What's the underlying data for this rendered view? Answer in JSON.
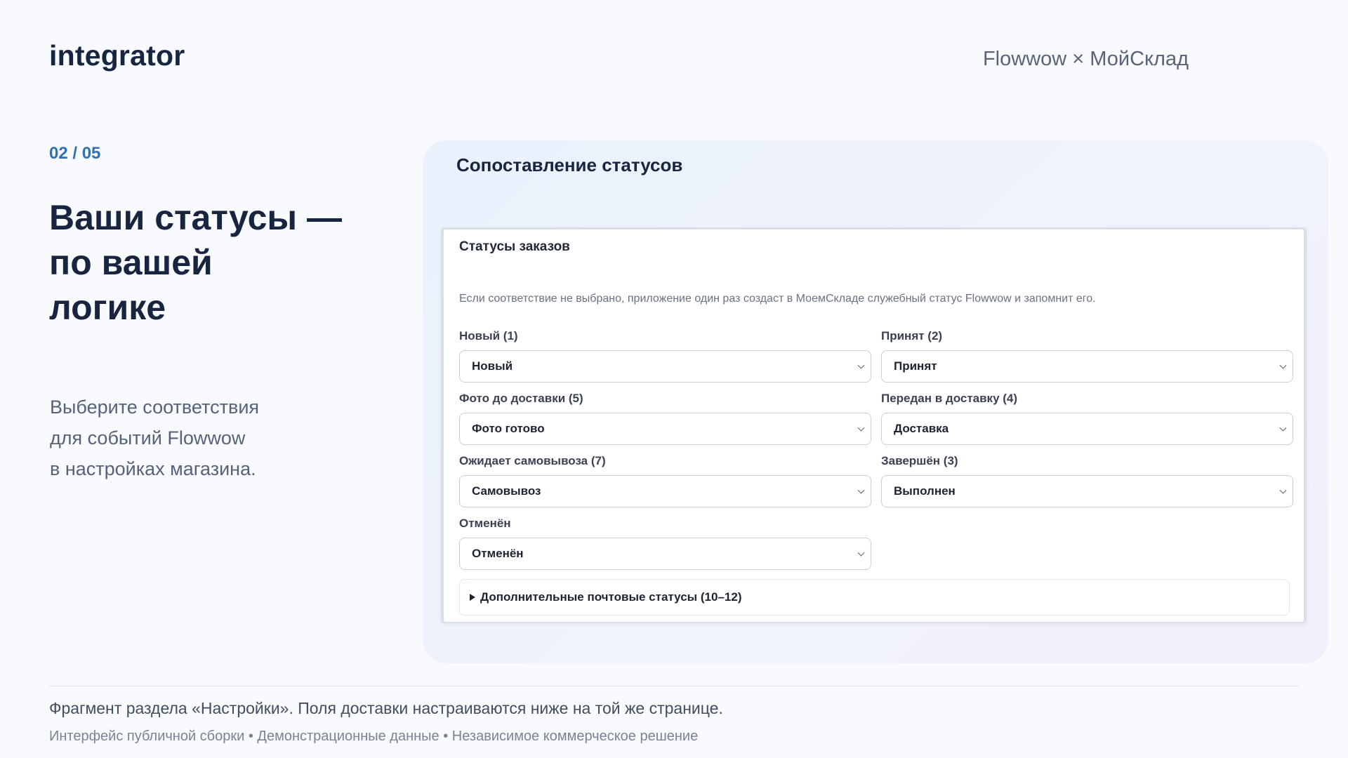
{
  "header": {
    "brand": "integrator",
    "product": "Flowwow × МойСклад"
  },
  "intro": {
    "step": "02 / 05",
    "headline_lines": [
      "Ваши статусы —",
      "по вашей",
      "логике"
    ],
    "subtext_lines": [
      "Выберите соответствия",
      "для событий Flowwow",
      "в настройках магазина."
    ]
  },
  "panel": {
    "title": "Сопоставление статусов",
    "card": {
      "title": "Статусы заказов",
      "note": "Если соответствие не выбрано, приложение один раз создаст в МоемСкладе служебный статус Flowwow и запомнит его.",
      "fields": [
        {
          "label": "Новый (1)",
          "value": "Новый"
        },
        {
          "label": "Принят (2)",
          "value": "Принят"
        },
        {
          "label": "Фото до доставки (5)",
          "value": "Фото готово"
        },
        {
          "label": "Передан в доставку (4)",
          "value": "Доставка"
        },
        {
          "label": "Ожидает самовывоза (7)",
          "value": "Самовывоз"
        },
        {
          "label": "Завершён (3)",
          "value": "Выполнен"
        },
        {
          "label": "Отменён",
          "value": "Отменён"
        }
      ],
      "details_label": "Дополнительные почтовые статусы (10–12)"
    }
  },
  "footer": {
    "main": "Фрагмент раздела «Настройки». Поля доставки настраиваются ниже на той же странице.",
    "sub": "Интерфейс публичной сборки • Демонстрационные данные • Независимое коммерческое решение"
  },
  "icons": {
    "select_arrow": "chevron-down-icon",
    "details_toggle": "triangle-right-icon"
  },
  "colors": {
    "accent": "#2f6fb6",
    "heading": "#172540",
    "panel_bg": "#eef2fc"
  }
}
